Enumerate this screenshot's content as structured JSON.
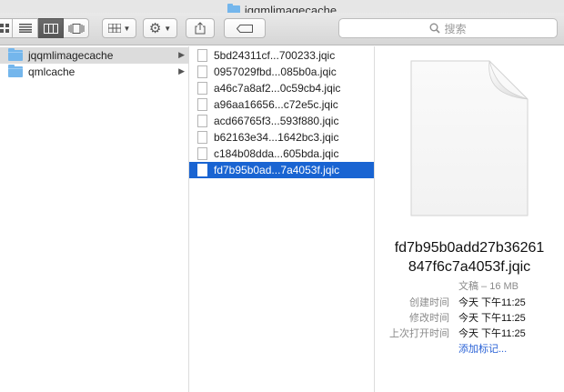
{
  "window": {
    "title": "jqqmlimagecache"
  },
  "toolbar": {
    "search_placeholder": "搜索"
  },
  "sidebar_column": {
    "items": [
      {
        "label": "jqqmlimagecache",
        "selected": true
      },
      {
        "label": "qmlcache",
        "selected": false
      }
    ]
  },
  "file_column": {
    "items": [
      {
        "label": "5bd24311cf...700233.jqic"
      },
      {
        "label": "0957029fbd...085b0a.jqic"
      },
      {
        "label": "a46c7a8af2...0c59cb4.jqic"
      },
      {
        "label": "a96aa16656...c72e5c.jqic"
      },
      {
        "label": "acd66765f3...593f880.jqic"
      },
      {
        "label": "b62163e34...1642bc3.jqic"
      },
      {
        "label": "c184b08dda...605bda.jqic"
      },
      {
        "label": "fd7b95b0ad...7a4053f.jqic",
        "selected": true
      }
    ]
  },
  "preview": {
    "name_line1": "fd7b95b0add27b36261",
    "name_line2": "847f6c7a4053f.jqic",
    "kind": "文稿 – 16 MB",
    "created_label": "创建时间",
    "created_value": "今天 下午11:25",
    "modified_label": "修改时间",
    "modified_value": "今天 下午11:25",
    "opened_label": "上次打开时间",
    "opened_value": "今天 下午11:25",
    "add_tags": "添加标记..."
  },
  "colors": {
    "selection": "#1964d2",
    "folder": "#74b6ec",
    "link": "#2a62d6"
  }
}
